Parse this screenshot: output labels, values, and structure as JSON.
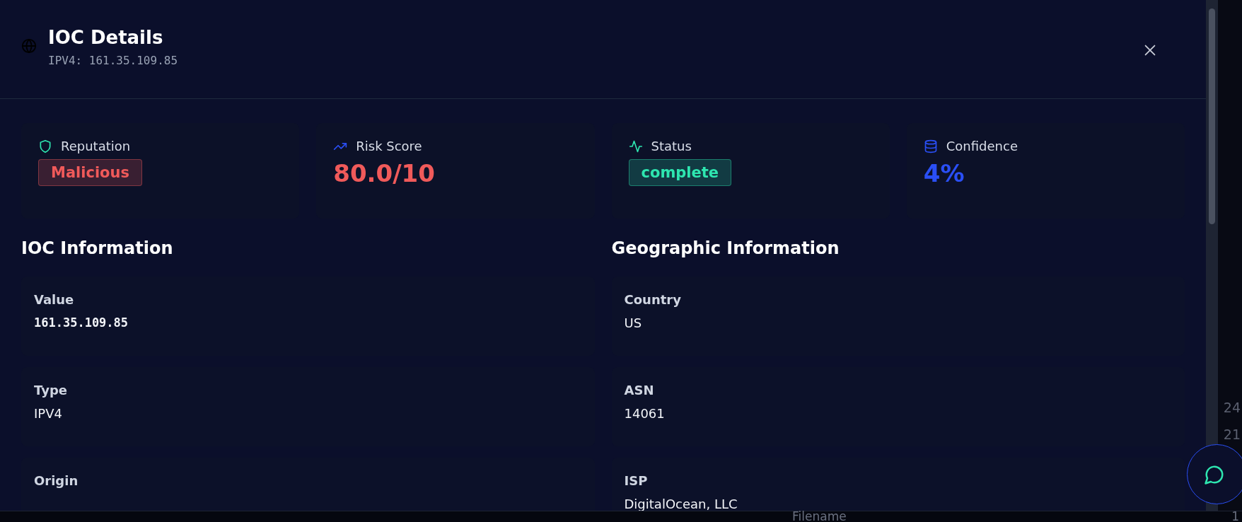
{
  "dialog": {
    "title": "IOC Details",
    "subtitle": "IPV4: 161.35.109.85"
  },
  "stats": [
    {
      "kind": "badge",
      "label": "Reputation",
      "value": "Malicious"
    },
    {
      "kind": "number",
      "label": "Risk Score",
      "value": "80.0/10"
    },
    {
      "kind": "badge",
      "label": "Status",
      "value": "complete"
    },
    {
      "kind": "number",
      "label": "Confidence",
      "value": "4%"
    }
  ],
  "sections": [
    {
      "title": "IOC Information",
      "fields": [
        {
          "kind": "code",
          "label": "Value",
          "value": "161.35.109.85"
        },
        {
          "kind": "text",
          "label": "Type",
          "value": "IPV4"
        },
        {
          "label": "Origin"
        }
      ]
    },
    {
      "title": "Geographic Information",
      "fields": [
        {
          "kind": "text",
          "label": "Country",
          "value": "US"
        },
        {
          "kind": "text",
          "label": "ASN",
          "value": "14061"
        },
        {
          "kind": "text",
          "label": "ISP",
          "value": "DigitalOcean, LLC"
        }
      ]
    }
  ],
  "background": {
    "numbers": [
      "24",
      "21"
    ],
    "column_label": "Filename",
    "last_number": "1"
  }
}
